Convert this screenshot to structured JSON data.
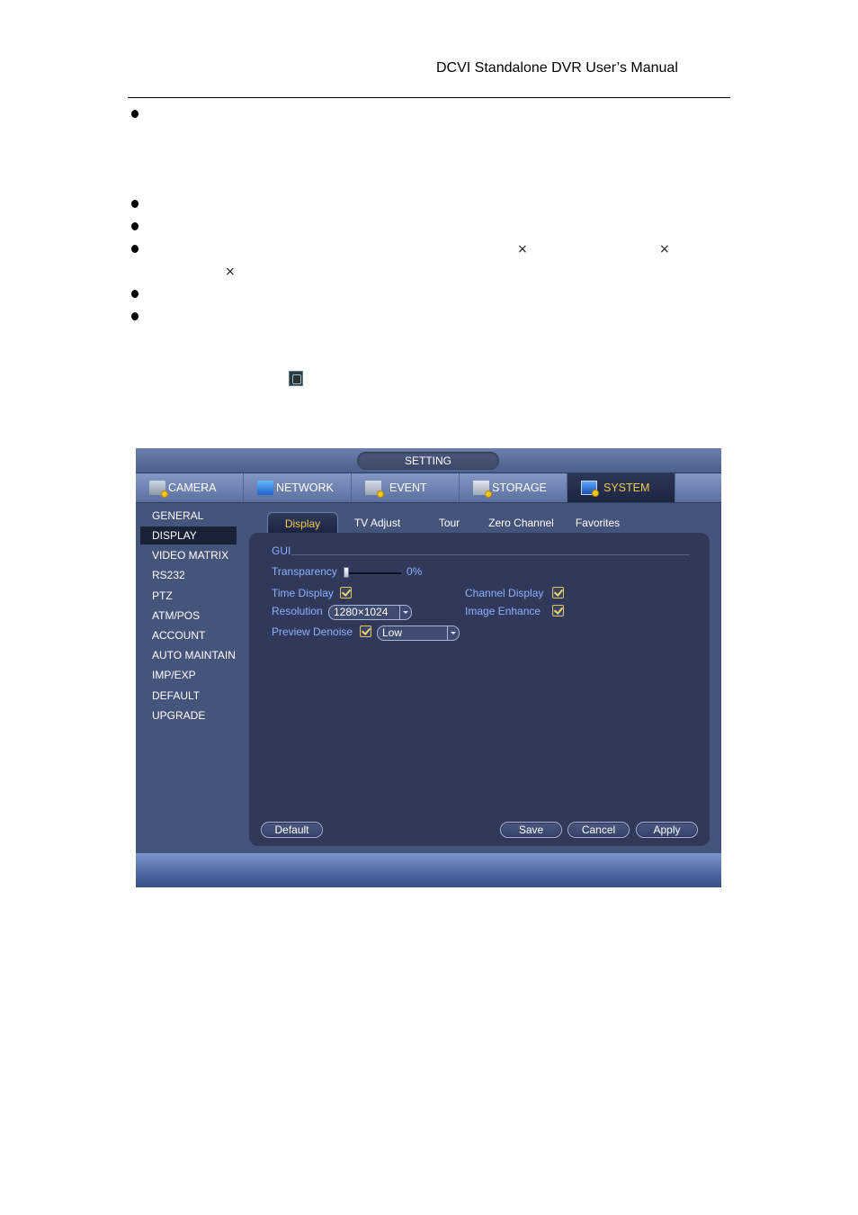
{
  "document": {
    "header": "DCVI Standalone DVR User’s Manual",
    "bullets": 6,
    "multiply_sign": "×",
    "inline_icon": "window-fullscreen-icon"
  },
  "dvr": {
    "window_title": "SETTING",
    "main_tabs": [
      {
        "label": "CAMERA",
        "icon": "camera-settings-icon",
        "active": false
      },
      {
        "label": "NETWORK",
        "icon": "network-icon",
        "active": false
      },
      {
        "label": "EVENT",
        "icon": "event-icon",
        "active": false
      },
      {
        "label": "STORAGE",
        "icon": "storage-icon",
        "active": false
      },
      {
        "label": "SYSTEM",
        "icon": "system-icon",
        "active": true
      }
    ],
    "sidebar": [
      {
        "label": "GENERAL",
        "active": false
      },
      {
        "label": "DISPLAY",
        "active": true
      },
      {
        "label": "VIDEO MATRIX",
        "active": false
      },
      {
        "label": "RS232",
        "active": false
      },
      {
        "label": "PTZ",
        "active": false
      },
      {
        "label": "ATM/POS",
        "active": false
      },
      {
        "label": "ACCOUNT",
        "active": false
      },
      {
        "label": "AUTO MAINTAIN",
        "active": false
      },
      {
        "label": "IMP/EXP",
        "active": false
      },
      {
        "label": "DEFAULT",
        "active": false
      },
      {
        "label": "UPGRADE",
        "active": false
      }
    ],
    "sub_tabs": [
      {
        "label": "Display",
        "active": true
      },
      {
        "label": "TV Adjust",
        "active": false
      },
      {
        "label": "Tour",
        "active": false
      },
      {
        "label": "Zero Channel",
        "active": false
      },
      {
        "label": "Favorites",
        "active": false
      }
    ],
    "gui": {
      "section_label": "GUI",
      "transparency_label": "Transparency",
      "transparency_value": "0%",
      "transparency_percent": 0,
      "time_display_label": "Time Display",
      "time_display_checked": true,
      "channel_display_label": "Channel Display",
      "channel_display_checked": true,
      "resolution_label": "Resolution",
      "resolution_value": "1280×1024",
      "image_enhance_label": "Image Enhance",
      "image_enhance_checked": true,
      "preview_denoise_label": "Preview Denoise",
      "preview_denoise_checked": true,
      "preview_denoise_value": "Low"
    },
    "buttons": {
      "default": "Default",
      "save": "Save",
      "cancel": "Cancel",
      "apply": "Apply"
    },
    "colors": {
      "accent_active": "#f2c94c",
      "label_blue": "#8fb0ff",
      "panel_bg": "#44547b",
      "content_bg": "#31395a"
    }
  }
}
